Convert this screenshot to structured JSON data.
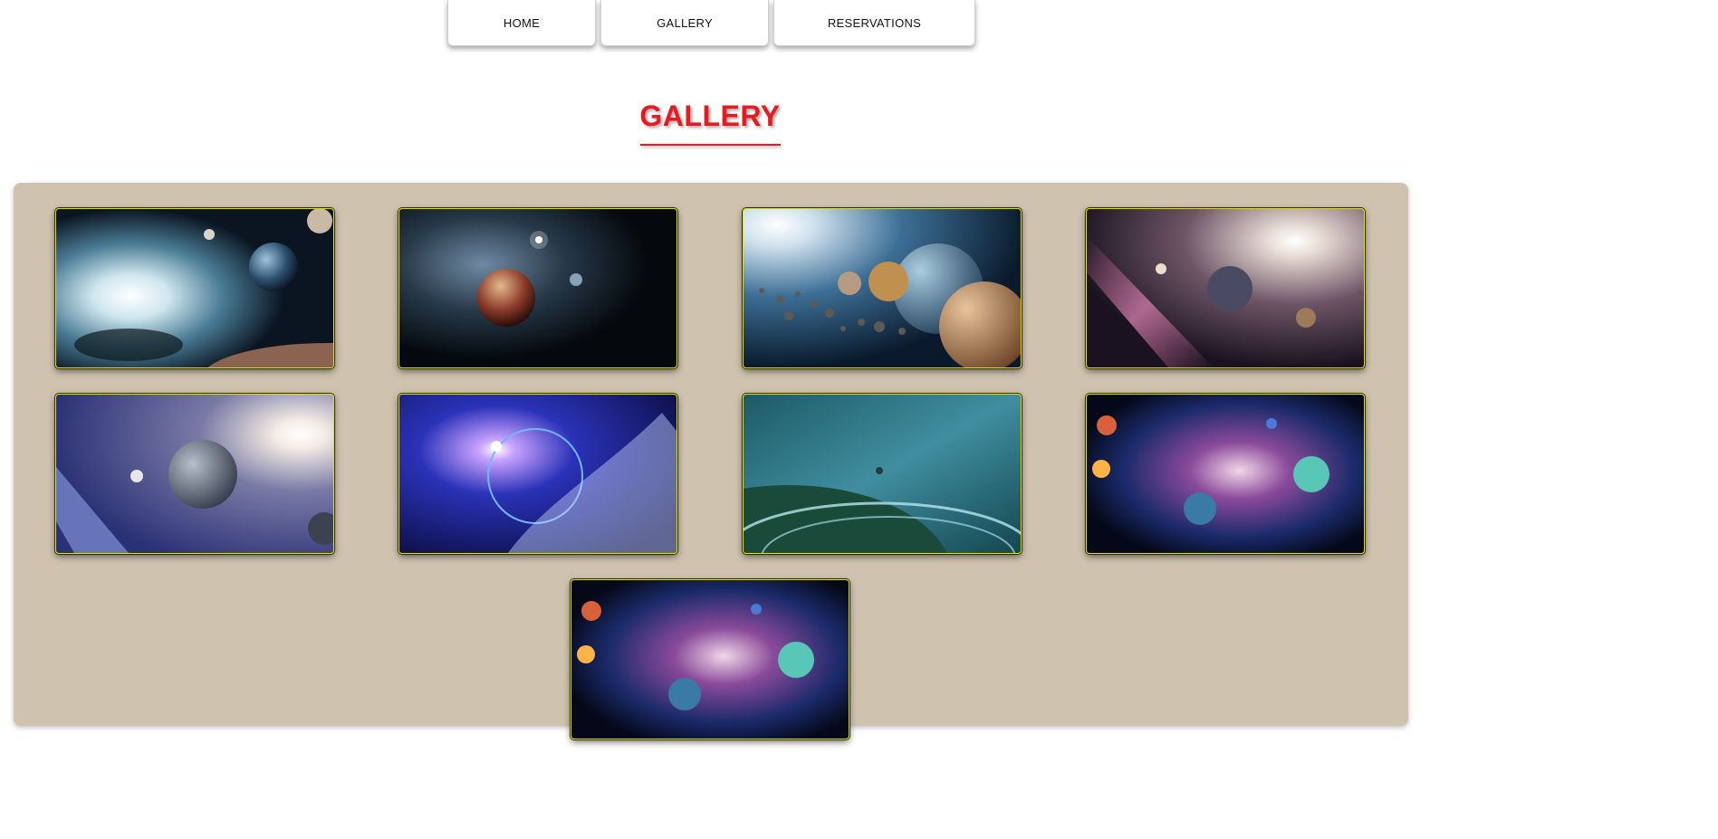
{
  "nav": {
    "home": "HOME",
    "gallery": "GALLERY",
    "reservations": "RESERVATIONS"
  },
  "page": {
    "title": "GALLERY"
  },
  "colors": {
    "title": "#e8191f",
    "panel": "#cfc3af",
    "thumb_border": "#e6e600"
  },
  "gallery": {
    "images": [
      {
        "name": "space-image-nebula-bright-star"
      },
      {
        "name": "space-image-red-planet-dark-nebula"
      },
      {
        "name": "space-image-planets-asteroid-belt"
      },
      {
        "name": "space-image-pink-milky-way-planets"
      },
      {
        "name": "space-image-blue-milky-way-moon"
      },
      {
        "name": "space-image-blue-nebula-ringed-planet"
      },
      {
        "name": "space-image-teal-ringed-planet"
      },
      {
        "name": "space-image-galaxy-colorful-planets"
      },
      {
        "name": "space-image-galaxy-colorful-planets-duplicate"
      }
    ]
  }
}
